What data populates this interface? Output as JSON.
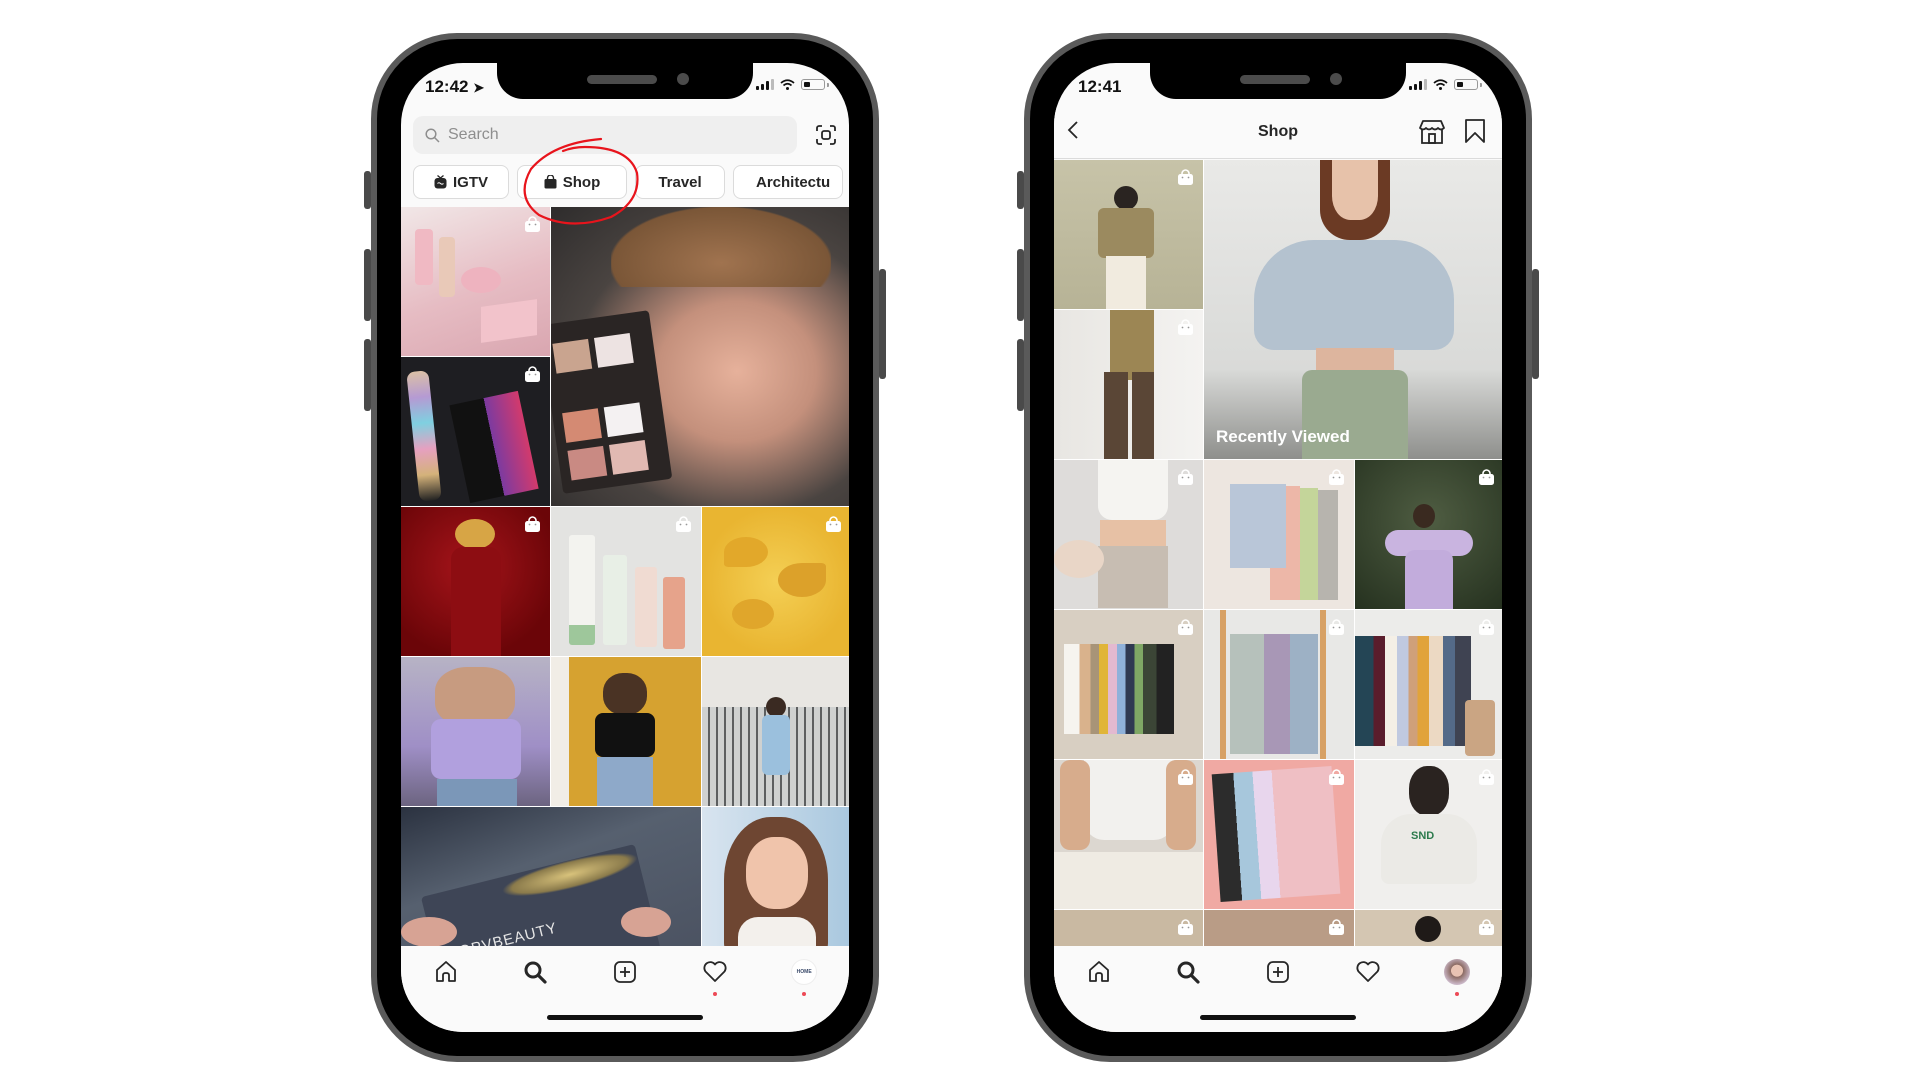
{
  "left_phone": {
    "status_time": "12:42",
    "search": {
      "placeholder": "Search"
    },
    "chips": [
      {
        "label": "IGTV",
        "icon": "igtv-icon"
      },
      {
        "label": "Shop",
        "icon": "shopping-bag-icon",
        "annotated": true
      },
      {
        "label": "Travel"
      },
      {
        "label": "Architectu"
      }
    ],
    "annotation_color": "#e8141c",
    "tiles": [
      {
        "desc": "pink Kylie skincare products",
        "color": "#e8c3c8",
        "shoppable": true
      },
      {
        "desc": "man holding makeup palette",
        "color": "#8a7466",
        "shoppable": false,
        "large": true
      },
      {
        "desc": "arm swatches and eyeshadow palette",
        "color": "#1e1e22",
        "shoppable": true
      },
      {
        "desc": "red bottle",
        "color": "#7a0a0c",
        "shoppable": true
      },
      {
        "desc": "Mario Badescu skincare bottles",
        "color": "#d9ddd7",
        "shoppable": true
      },
      {
        "desc": "golden serum drops",
        "color": "#e9b73a",
        "shoppable": true
      },
      {
        "desc": "woman in lavender crop top",
        "color": "#a99ac2",
        "shoppable": false
      },
      {
        "desc": "woman in black top yellow wall",
        "color": "#d8a328",
        "shoppable": false
      },
      {
        "desc": "woman on balcony",
        "color": "#c8c5c1",
        "shoppable": false
      },
      {
        "desc": "OPV Beauty palette unboxing",
        "color": "#3f4552",
        "shoppable": false,
        "wide": true,
        "text": "OPVBEAUTY"
      },
      {
        "desc": "smiling woman selfie",
        "color": "#b48a76",
        "shoppable": false
      }
    ],
    "nav": [
      "home-icon",
      "search-icon",
      "new-post-icon",
      "activity-icon",
      "profile-icon"
    ]
  },
  "right_phone": {
    "status_time": "12:41",
    "header": {
      "title": "Shop"
    },
    "recently_viewed_label": "Recently Viewed",
    "tiles": [
      {
        "desc": "person in plaid blazer",
        "color": "#b8b49a",
        "shoppable": true
      },
      {
        "desc": "woman in blue puff-sleeve top",
        "color": "#c9cdd0",
        "shoppable": false,
        "large": true
      },
      {
        "desc": "plaid blazer and brown tights",
        "color": "#8a7a5b",
        "shoppable": true
      },
      {
        "desc": "white crop top with pancakes",
        "color": "#e2e0dc",
        "shoppable": true
      },
      {
        "desc": "pastel cardigans on hangers",
        "color": "#c9cfd8",
        "shoppable": true
      },
      {
        "desc": "woman in lilac dress in forest",
        "color": "#3b4a33",
        "shoppable": true
      },
      {
        "desc": "colorful tank tops on rail",
        "color": "#d5cbbd",
        "shoppable": true
      },
      {
        "desc": "blazers on wooden rack",
        "color": "#b7bcb8",
        "shoppable": true
      },
      {
        "desc": "dresses on rail",
        "color": "#8a8890",
        "shoppable": true
      },
      {
        "desc": "woman in white tank top",
        "color": "#d9d4cd",
        "shoppable": true
      },
      {
        "desc": "folded pastel tees",
        "color": "#e6b3b0",
        "shoppable": true
      },
      {
        "desc": "woman in SND sweatshirt",
        "color": "#d7d3cd",
        "shoppable": true
      },
      {
        "desc": "shelf display",
        "color": "#c9b79f",
        "shoppable": true
      },
      {
        "desc": "woman in mirror",
        "color": "#a68d7b",
        "shoppable": true
      },
      {
        "desc": "woman in room",
        "color": "#c8b9a3",
        "shoppable": true
      }
    ],
    "nav": [
      "home-icon",
      "search-icon",
      "new-post-icon",
      "activity-icon",
      "profile-avatar"
    ]
  }
}
